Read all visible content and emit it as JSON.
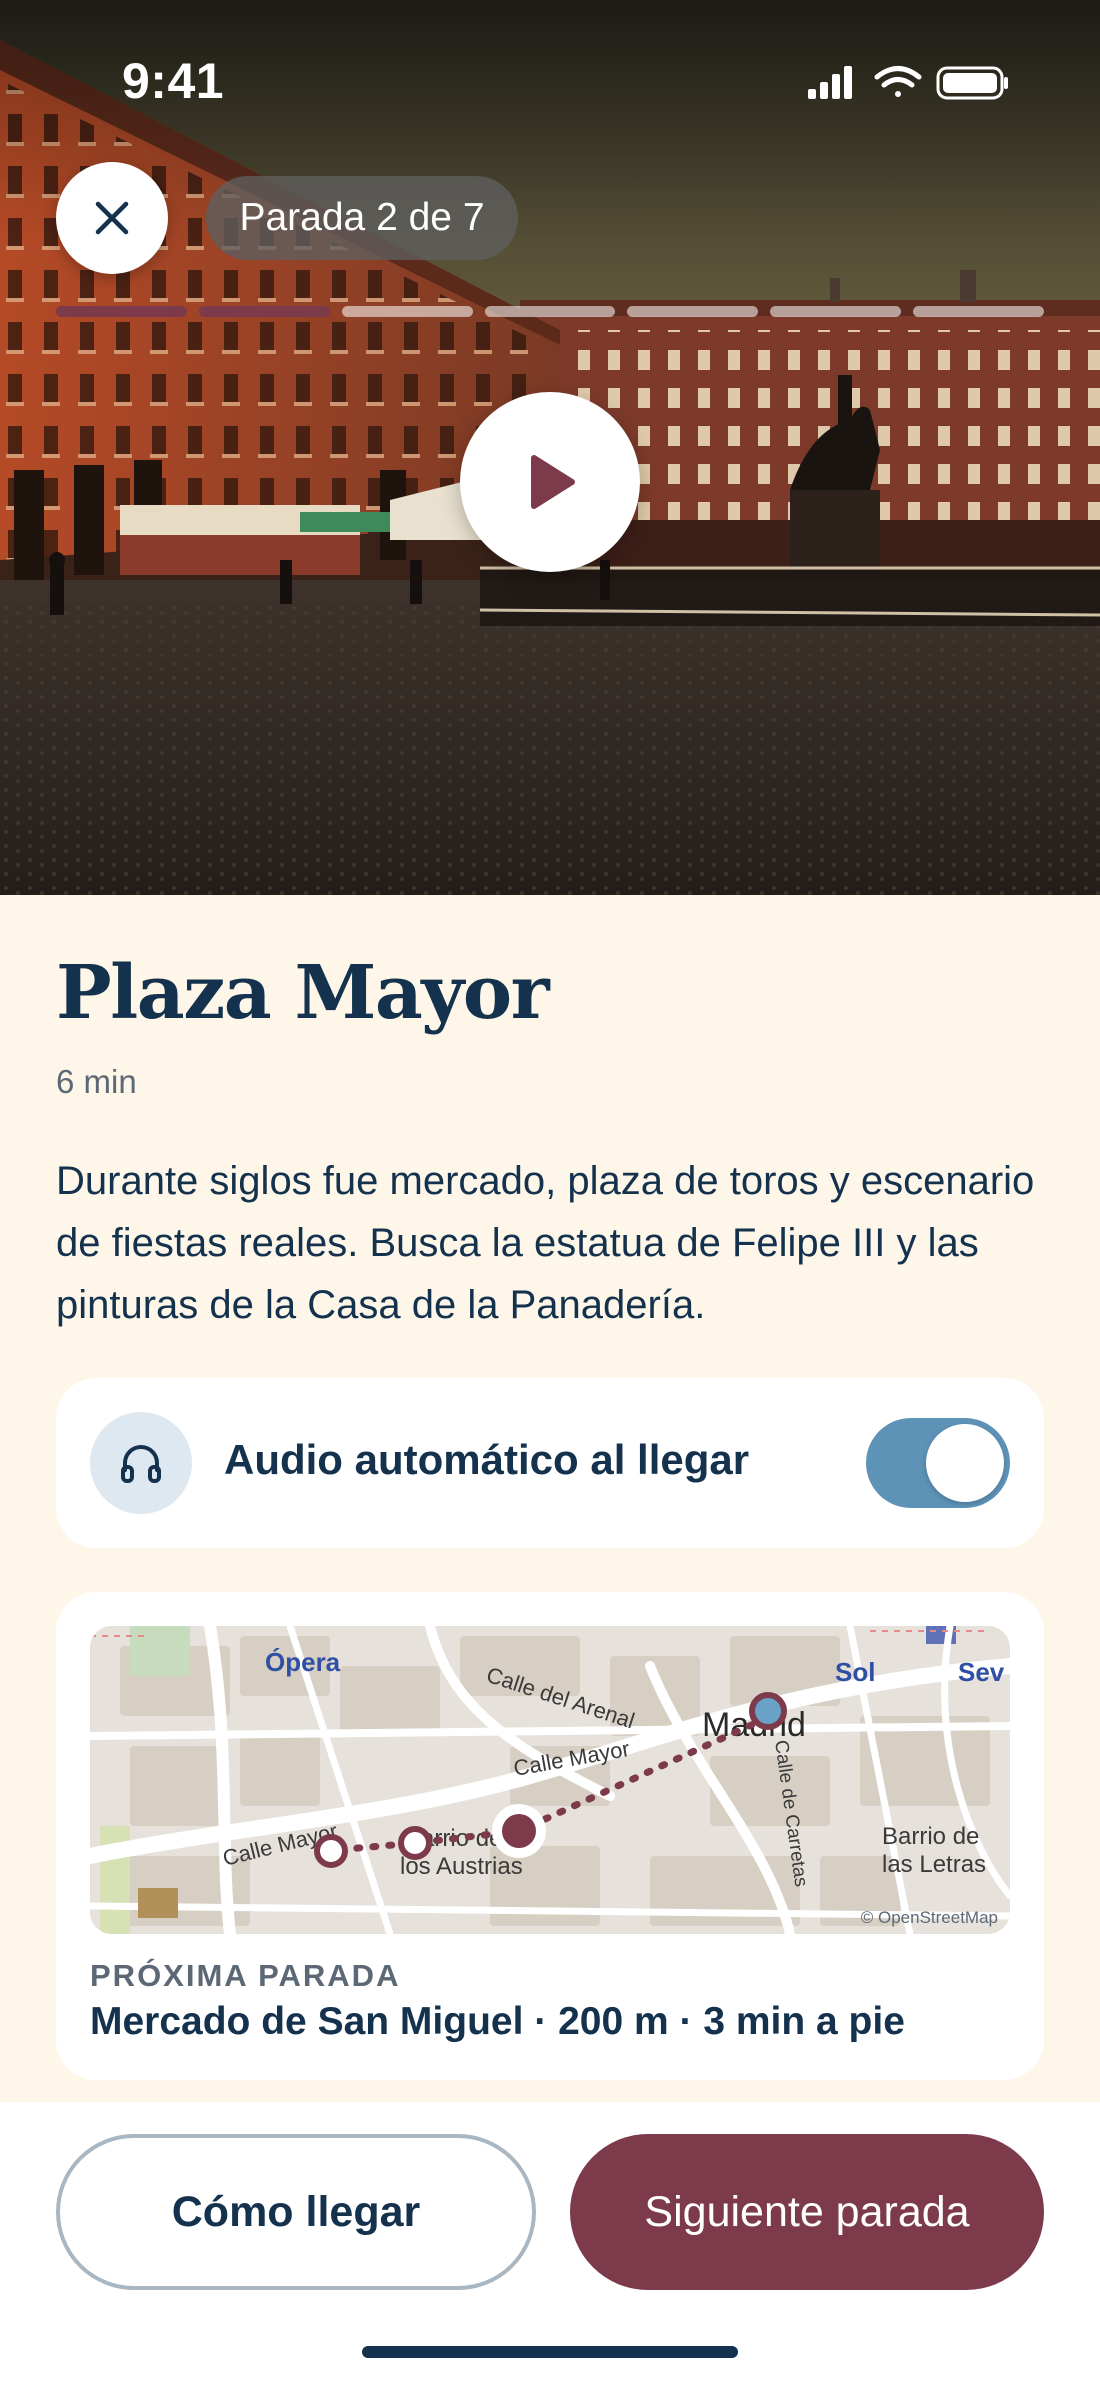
{
  "status_bar": {
    "time": "9:41",
    "icons": [
      "signal-icon",
      "wifi-icon",
      "battery-icon"
    ]
  },
  "header": {
    "close_icon": "close-icon",
    "stop_indicator": "Parada 2 de 7",
    "progress": {
      "total_segments": 7,
      "completed_segments": 2
    }
  },
  "player": {
    "play_icon": "play-icon"
  },
  "stop": {
    "title": "Plaza Mayor",
    "duration": "6 min",
    "description": "Durante siglos fue mercado, plaza de toros y escenario de fiestas reales. Busca la estatua de Felipe III y las pinturas de la Casa de la Panadería."
  },
  "audio_setting": {
    "icon": "headphones-icon",
    "label": "Audio automático al llegar",
    "enabled": true
  },
  "map": {
    "labels": {
      "opera": "Ópera",
      "arenal": "Calle del Arenal",
      "madrid": "Madrid",
      "sol": "Sol",
      "sev": "Sev",
      "calle_mayor_1": "Calle Mayor",
      "calle_mayor_2": "Calle Mayor",
      "barrio_austrias_1": "Barrio de",
      "barrio_austrias_2": "los Austrias",
      "barrio_letras_1": "Barrio de",
      "barrio_letras_2": "las Letras",
      "carretas": "Calle de Carretas",
      "attribution": "© OpenStreetMap"
    }
  },
  "next_stop": {
    "label": "PRÓXIMA PARADA",
    "value": "Mercado de San Miguel · 200 m · 3 min a pie"
  },
  "actions": {
    "directions": "Cómo llegar",
    "next": "Siguiente parada"
  },
  "colors": {
    "accent": "#7c3a4b",
    "navy": "#14324d",
    "toggle_on": "#5e93b8",
    "background": "#fdf6e9"
  }
}
